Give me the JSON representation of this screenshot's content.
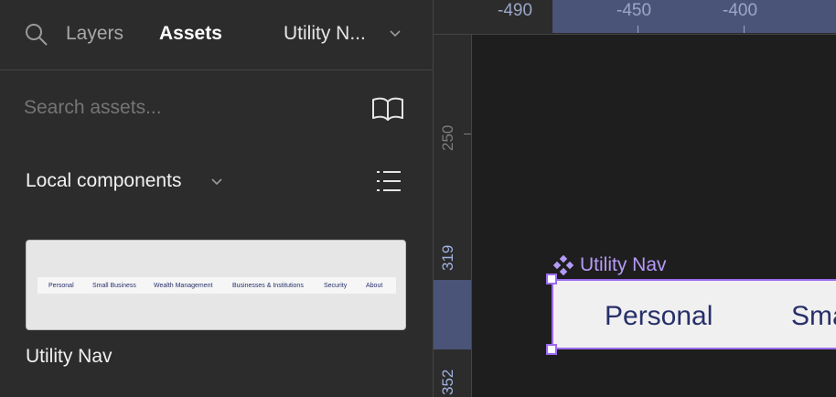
{
  "sidebar": {
    "tabs": [
      {
        "label": "Layers",
        "active": false
      },
      {
        "label": "Assets",
        "active": true
      }
    ],
    "page_selector": "Utility N...",
    "search_placeholder": "Search assets...",
    "section_title": "Local components",
    "component": {
      "name": "Utility Nav",
      "preview_items": [
        "Personal",
        "Small Business",
        "Wealth Management",
        "Businesses & Institutions",
        "Security",
        "About"
      ]
    }
  },
  "canvas": {
    "ruler_top_labels": [
      "-490",
      "-450",
      "-400"
    ],
    "ruler_left_labels": [
      "250",
      "319",
      "352"
    ],
    "component_label": "Utility Nav",
    "frame_items": [
      "Personal",
      "Sma"
    ]
  },
  "colors": {
    "panel_bg": "#2c2c2c",
    "canvas_bg": "#1e1e1e",
    "selection": "#9b6cf0",
    "ruler_highlight": "#4a5478",
    "nav_text": "#27306a"
  },
  "icons": [
    "search-icon",
    "chevron-down-icon",
    "book-icon",
    "list-view-icon",
    "component-icon"
  ]
}
